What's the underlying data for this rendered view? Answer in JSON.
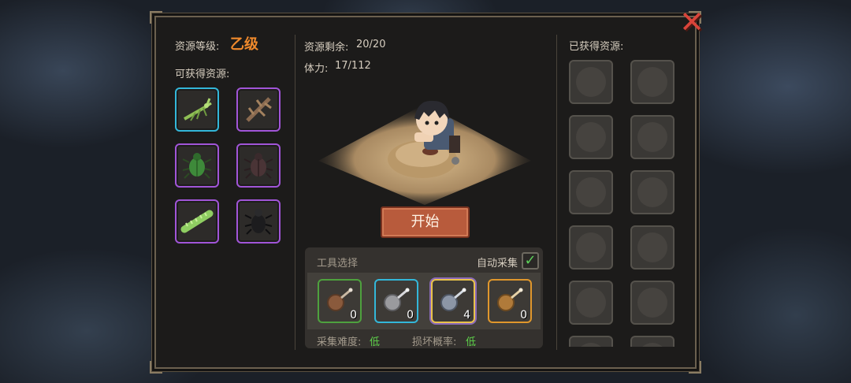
{
  "left": {
    "grade_label": "资源等级:",
    "grade_value": "乙级",
    "obtainable_label": "可获得资源:",
    "resources": [
      {
        "name": "mantis-icon",
        "rarity": "blue"
      },
      {
        "name": "branch-insect-icon",
        "rarity": "purple"
      },
      {
        "name": "green-beetle-icon",
        "rarity": "purple"
      },
      {
        "name": "brown-beetle-icon",
        "rarity": "purple"
      },
      {
        "name": "caterpillar-icon",
        "rarity": "purple"
      },
      {
        "name": "black-beetle-icon",
        "rarity": "purple"
      }
    ]
  },
  "center": {
    "remaining_label": "资源剩余:",
    "remaining_value": "20/20",
    "stamina_label": "体力:",
    "stamina_value": "17/112",
    "start_button": "开始",
    "tools_title": "工具选择",
    "auto_collect_label": "自动采集",
    "auto_collect_checked": true,
    "tools": [
      {
        "name": "bronze-net-icon",
        "rarity": "green",
        "count": "0"
      },
      {
        "name": "silver-net-icon",
        "rarity": "blue",
        "count": "0"
      },
      {
        "name": "steel-net-icon",
        "rarity": "gold",
        "count": "4"
      },
      {
        "name": "gold-net-icon",
        "rarity": "orange",
        "count": "0"
      }
    ],
    "difficulty_label": "采集难度:",
    "difficulty_value": "低",
    "break_label": "损坏概率:",
    "break_value": "低"
  },
  "right": {
    "obtained_label": "已获得资源:"
  },
  "colors": {
    "grade": "#f08a2c",
    "low_value": "#5ed24a",
    "close": "#d9443a"
  }
}
